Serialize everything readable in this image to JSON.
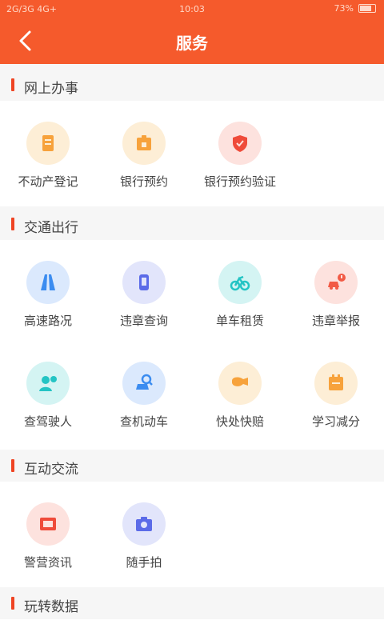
{
  "status_bar": {
    "carrier": "2G/3G 4G+",
    "time": "10:03",
    "battery": "73%"
  },
  "nav": {
    "title": "服务"
  },
  "sections": [
    {
      "title": "网上办事",
      "items": [
        {
          "label": "不动产登记",
          "icon": "document-icon",
          "color": "#f7a23b"
        },
        {
          "label": "银行预约",
          "icon": "bank-icon",
          "color": "#f7a23b"
        },
        {
          "label": "银行预约验证",
          "icon": "shield-icon",
          "color": "#ef4b3a"
        }
      ]
    },
    {
      "title": "交通出行",
      "items": [
        {
          "label": "高速路况",
          "icon": "road-icon",
          "color": "#3b8cf0"
        },
        {
          "label": "违章查询",
          "icon": "phone-icon",
          "color": "#5b6be8"
        },
        {
          "label": "单车租赁",
          "icon": "bicycle-icon",
          "color": "#24c4c4"
        },
        {
          "label": "违章举报",
          "icon": "car-report-icon",
          "color": "#f25a45"
        },
        {
          "label": "查驾驶人",
          "icon": "driver-icon",
          "color": "#24c4c4"
        },
        {
          "label": "查机动车",
          "icon": "car-search-icon",
          "color": "#3b8cf0"
        },
        {
          "label": "快处快赔",
          "icon": "horn-icon",
          "color": "#f7a23b"
        },
        {
          "label": "学习减分",
          "icon": "book-icon",
          "color": "#f7a23b"
        }
      ]
    },
    {
      "title": "互动交流",
      "items": [
        {
          "label": "警营资讯",
          "icon": "news-icon",
          "color": "#ef4b3a"
        },
        {
          "label": "随手拍",
          "icon": "camera-icon",
          "color": "#5b6be8"
        }
      ]
    },
    {
      "title": "玩转数据",
      "items": []
    }
  ]
}
